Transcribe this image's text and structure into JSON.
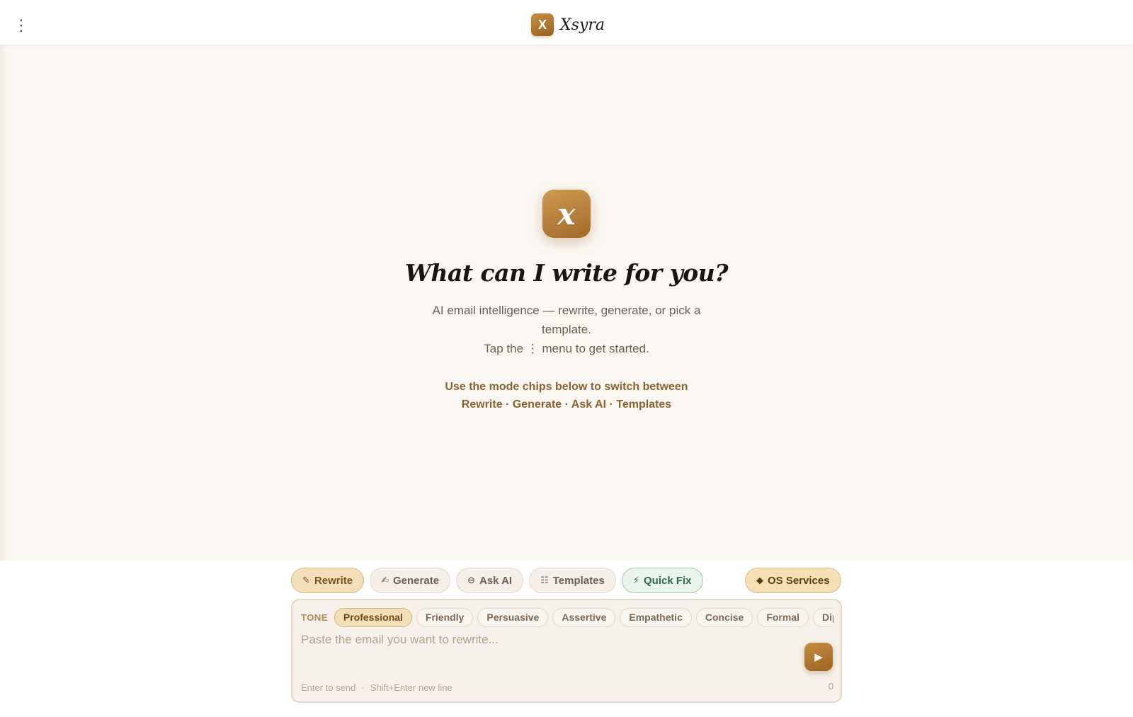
{
  "app": {
    "name": "Xsyra",
    "logo_letter": "X",
    "menu_glyph": "⋮"
  },
  "hero": {
    "logo_letter": "x",
    "title": "What can I write for you?",
    "subtitle_line1": "AI email intelligence — rewrite, generate, or pick a template.",
    "subtitle_line2": "Tap the ⋮ menu to get started.",
    "hint_line1": "Use the mode chips below to switch between",
    "hint_line2": "Rewrite · Generate · Ask AI · Templates"
  },
  "modes": [
    {
      "label": "Rewrite",
      "icon": "✎",
      "active": true
    },
    {
      "label": "Generate",
      "icon": "✍",
      "active": false
    },
    {
      "label": "Ask AI",
      "icon": "⊖",
      "active": false
    },
    {
      "label": "Templates",
      "icon": "☷",
      "active": false
    },
    {
      "label": "Quick Fix",
      "icon": "⚡",
      "active": false
    }
  ],
  "os_services": {
    "label": "OS Services",
    "icon": "◆"
  },
  "composer": {
    "tone_label": "TONE",
    "tones": [
      "Professional",
      "Friendly",
      "Persuasive",
      "Assertive",
      "Empathetic",
      "Concise",
      "Formal",
      "Diplomatic"
    ],
    "selected_tone": "Professional",
    "placeholder": "Paste the email you want to rewrite...",
    "value": "",
    "send_icon": "▶",
    "footer_send": "Enter to send",
    "footer_sep": "·",
    "footer_newline": "Shift+Enter new line",
    "char_count": "0"
  },
  "colors": {
    "accent": "#b27a36",
    "background": "#faf7f2",
    "active_chip": "#f3dfb8",
    "quick_fix": "#e9f4ec"
  }
}
